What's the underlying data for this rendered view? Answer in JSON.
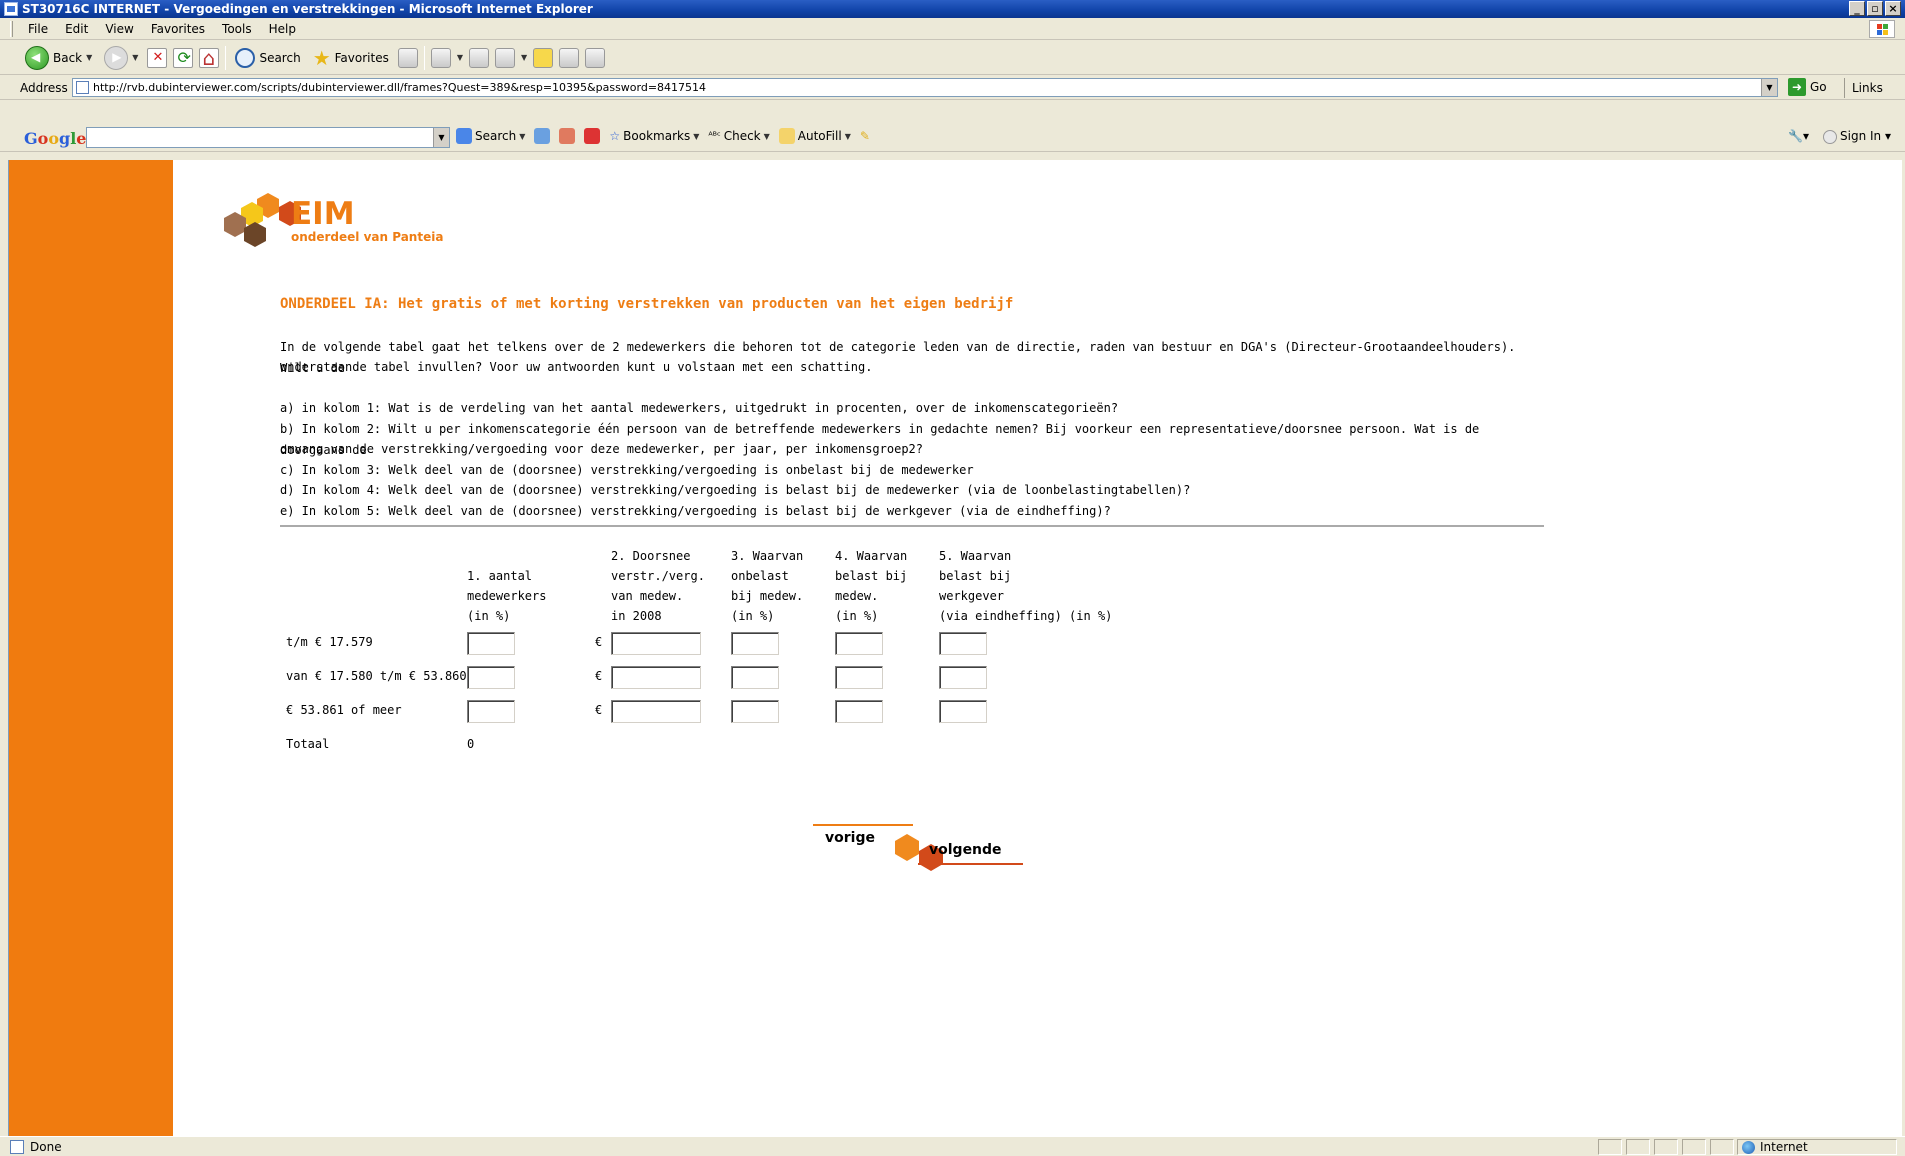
{
  "window": {
    "title": "ST30716C INTERNET - Vergoedingen en verstrekkingen - Microsoft Internet Explorer",
    "controls": [
      "_",
      "▫",
      "×"
    ]
  },
  "menubar": {
    "items": [
      "File",
      "Edit",
      "View",
      "Favorites",
      "Tools",
      "Help"
    ]
  },
  "toolbar": {
    "back_label": "Back",
    "search_label": "Search",
    "favorites_label": "Favorites"
  },
  "addressbar": {
    "label": "Address",
    "url": "http://rvb.dubinterviewer.com/scripts/dubinterviewer.dll/frames?Quest=389&resp=10395&password=8417514",
    "go_label": "Go",
    "links_label": "Links"
  },
  "googlebar": {
    "search_label": "Search",
    "bookmarks_label": "Bookmarks",
    "check_label": "Check",
    "autofill_label": "AutoFill",
    "signin_label": "Sign In"
  },
  "page": {
    "logo_title": "EIM",
    "logo_subtitle": "onderdeel van Panteia",
    "heading": "ONDERDEEL IA: Het gratis of met korting verstrekken van producten van het eigen bedrijf",
    "intro_line1": "In de volgende tabel gaat het telkens over de 2 medewerkers die behoren tot de categorie leden van de directie, raden van bestuur en DGA's (Directeur-Grootaandeelhouders). Wilt u de",
    "intro_line2": "onderstaande tabel invullen? Voor uw antwoorden kunt u volstaan met een schatting.",
    "instructions": [
      "a) in kolom 1: Wat is de verdeling van het aantal medewerkers, uitgedrukt in procenten, over de inkomenscategorieën?",
      "b) In kolom 2: Wilt u per inkomenscategorie één persoon van de betreffende medewerkers in gedachte nemen? Bij voorkeur een representatieve/doorsnee persoon. Wat is de doorgaans de",
      "omvang van de verstrekking/vergoeding voor deze medewerker, per jaar, per inkomensgroep2?",
      "c) In kolom 3: Welk deel van de (doorsnee) verstrekking/vergoeding is onbelast bij de medewerker",
      "d) In kolom 4: Welk deel van de (doorsnee) verstrekking/vergoeding is belast bij de medewerker (via de loonbelastingtabellen)?",
      "e) In kolom 5: Welk deel van de (doorsnee) verstrekking/vergoeding is belast bij de werkgever (via de eindheffing)?"
    ],
    "table": {
      "columns": [
        "\n1. aantal\nmedewerkers\n(in %)",
        "2. Doorsnee\nverstr./verg.\nvan medew.\nin 2008",
        "3. Waarvan\nonbelast\nbij medew.\n(in %)",
        "4. Waarvan\nbelast bij\nmedew.\n(in %)",
        "5. Waarvan\nbelast bij\nwerkgever\n(via eindheffing) (in %)"
      ],
      "rows": [
        {
          "label": "t/m € 17.579",
          "col1": "",
          "col2": "",
          "col3": "",
          "col4": "",
          "col5": ""
        },
        {
          "label": "van € 17.580 t/m € 53.860",
          "col1": "",
          "col2": "",
          "col3": "",
          "col4": "",
          "col5": ""
        },
        {
          "label": "€ 53.861 of meer",
          "col1": "",
          "col2": "",
          "col3": "",
          "col4": "",
          "col5": ""
        }
      ],
      "currency_symbol": "€",
      "total_label": "Totaal",
      "total_value": "0"
    },
    "nav": {
      "prev_label": "vorige",
      "next_label": "volgende"
    }
  },
  "statusbar": {
    "status": "Done",
    "zone": "Internet"
  },
  "colors": {
    "sidebar": "#f07b0f",
    "accent_orange": "#ee7d14",
    "title_bar": "#1043a8"
  }
}
